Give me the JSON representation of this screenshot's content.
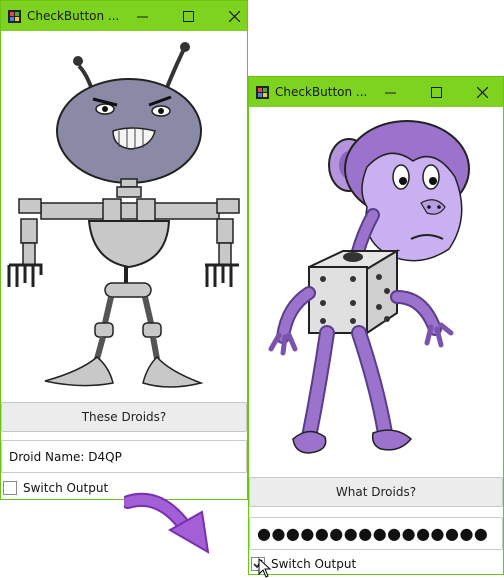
{
  "window_left": {
    "title": "CheckButton ...",
    "button_label": "These Droids?",
    "field_text": "Droid Name: D4QP",
    "checkbox_label": "Switch Output",
    "checkbox_checked": false
  },
  "window_right": {
    "title": "CheckButton ...",
    "button_label": "What Droids?",
    "field_text": "●●●●●●●●●●●●●●●●",
    "checkbox_label": "Switch Output",
    "checkbox_checked": true
  },
  "colors": {
    "titlebar": "#7ed321",
    "robot_body": "#c8c8c8",
    "robot_head": "#8a8aa6",
    "monkey": "#9b72cc",
    "arrow": "#a35fd6"
  },
  "icons": {
    "minimize": "minimize-icon",
    "maximize": "maximize-icon",
    "close": "close-icon",
    "arrow": "arrow-icon"
  }
}
